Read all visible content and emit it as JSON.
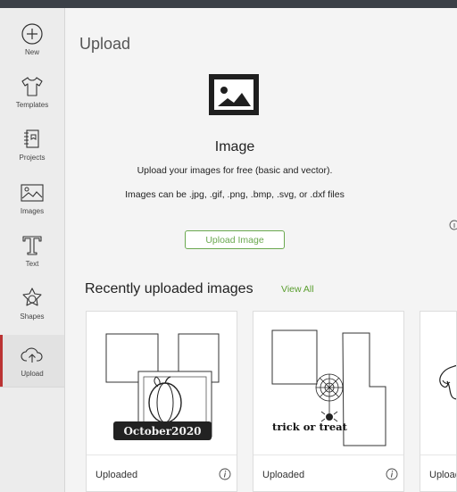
{
  "sidebar": {
    "items": [
      {
        "label": "New",
        "icon": "plus-circle-icon"
      },
      {
        "label": "Templates",
        "icon": "tshirt-icon"
      },
      {
        "label": "Projects",
        "icon": "notebook-icon"
      },
      {
        "label": "Images",
        "icon": "image-icon"
      },
      {
        "label": "Text",
        "icon": "text-t-icon"
      },
      {
        "label": "Shapes",
        "icon": "shapes-icon"
      },
      {
        "label": "Upload",
        "icon": "cloud-upload-icon",
        "active": true
      }
    ]
  },
  "main": {
    "title": "Upload",
    "hero": {
      "icon": "image-upload-icon",
      "title": "Image",
      "line1": "Upload your images for free (basic and vector).",
      "line2": "Images can be .jpg, .gif, .png, .bmp, .svg, or .dxf files",
      "button_label": "Upload Image"
    },
    "recent": {
      "title": "Recently uploaded images",
      "view_all": "View All",
      "cards": [
        {
          "status": "Uploaded",
          "thumb_text": "October2020"
        },
        {
          "status": "Uploaded",
          "thumb_text": "trick or treat"
        },
        {
          "status": "Uploaded"
        }
      ]
    }
  },
  "colors": {
    "accent_green": "#6aa84f",
    "active_red": "#b33",
    "topbar": "#3b4047"
  }
}
